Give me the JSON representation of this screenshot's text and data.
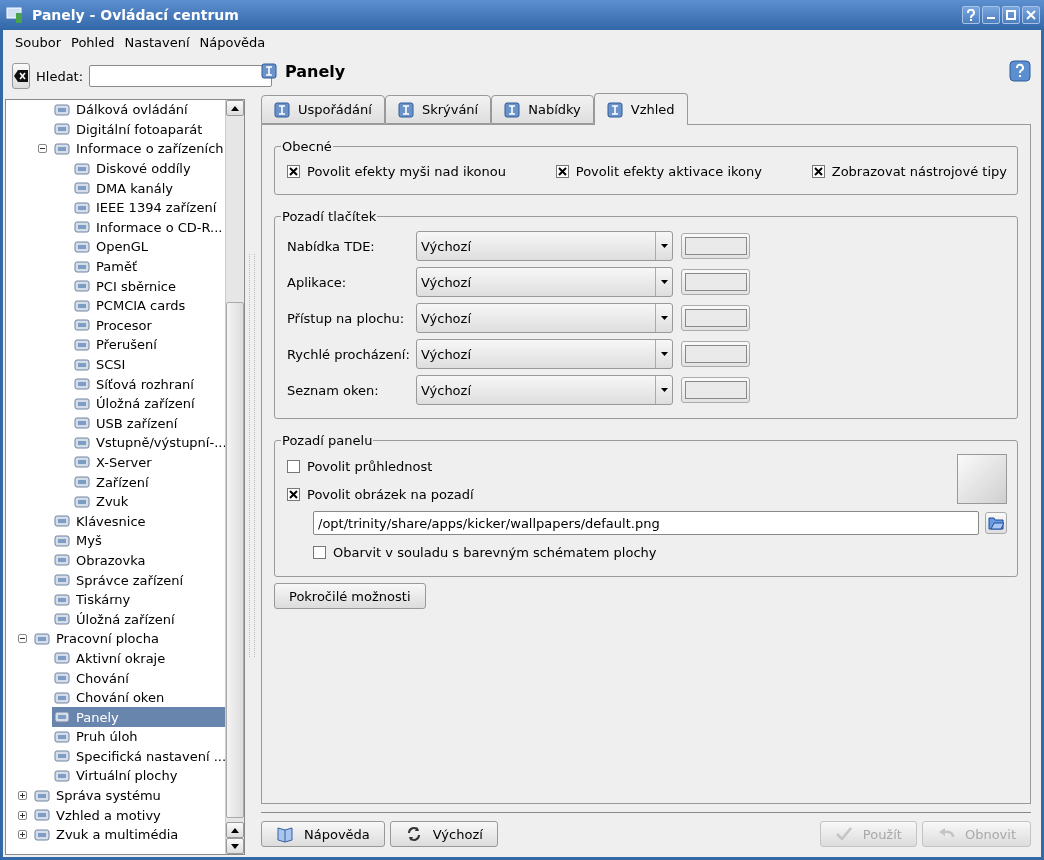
{
  "window": {
    "title": "Panely - Ovládací centrum"
  },
  "menu": [
    {
      "label": "Soubor"
    },
    {
      "label": "Pohled"
    },
    {
      "label": "Nastavení"
    },
    {
      "label": "Nápověda"
    }
  ],
  "search": {
    "label": "Hledat:"
  },
  "tree": {
    "partial_group": {
      "children": [
        {
          "label": "Dálková ovládání"
        },
        {
          "label": "Digitální fotoaparát"
        },
        {
          "label": "Informace o zařízeních",
          "expanded": true,
          "children": [
            {
              "label": "Diskové oddíly"
            },
            {
              "label": "DMA kanály"
            },
            {
              "label": "IEEE 1394 zařízení"
            },
            {
              "label": "Informace o CD-R..."
            },
            {
              "label": "OpenGL"
            },
            {
              "label": "Paměť"
            },
            {
              "label": "PCI sběrnice"
            },
            {
              "label": "PCMCIA cards"
            },
            {
              "label": "Procesor"
            },
            {
              "label": "Přerušení"
            },
            {
              "label": "SCSI"
            },
            {
              "label": "Síťová rozhraní"
            },
            {
              "label": "Úložná zařízení"
            },
            {
              "label": "USB zařízení"
            },
            {
              "label": "Vstupně/výstupní-..."
            },
            {
              "label": "X-Server"
            },
            {
              "label": "Zařízení"
            },
            {
              "label": "Zvuk"
            }
          ]
        },
        {
          "label": "Klávesnice"
        },
        {
          "label": "Myš"
        },
        {
          "label": "Obrazovka"
        },
        {
          "label": "Správce zařízení"
        },
        {
          "label": "Tiskárny"
        },
        {
          "label": "Úložná zařízení"
        }
      ]
    },
    "items": [
      {
        "label": "Pracovní plocha",
        "expanded": true,
        "children": [
          {
            "label": "Aktivní okraje",
            "selected": false
          },
          {
            "label": "Chování",
            "selected": false
          },
          {
            "label": "Chování oken",
            "selected": false
          },
          {
            "label": "Panely",
            "selected": true
          },
          {
            "label": "Pruh úloh",
            "selected": false
          },
          {
            "label": "Specifická nastavení ...",
            "selected": false
          },
          {
            "label": "Virtuální plochy",
            "selected": false
          }
        ]
      },
      {
        "label": "Správa systému",
        "expanded": false
      },
      {
        "label": "Vzhled a motivy",
        "expanded": false
      },
      {
        "label": "Zvuk a multimédia",
        "expanded": false
      }
    ]
  },
  "page": {
    "title": "Panely",
    "tabs": [
      {
        "label": "Uspořádání",
        "selected": false
      },
      {
        "label": "Skrývání",
        "selected": false
      },
      {
        "label": "Nabídky",
        "selected": false
      },
      {
        "label": "Vzhled",
        "selected": true
      }
    ],
    "general": {
      "title": "Obecné",
      "checkboxes": [
        {
          "label": "Povolit efekty myši nad ikonou",
          "checked": true
        },
        {
          "label": "Povolit efekty aktivace ikony",
          "checked": true
        },
        {
          "label": "Zobrazovat nástrojové tipy",
          "checked": true
        }
      ]
    },
    "button_backgrounds": {
      "title": "Pozadí tlačítek",
      "rows": [
        {
          "label": "Nabídka TDE:",
          "value": "Výchozí"
        },
        {
          "label": "Aplikace:",
          "value": "Výchozí"
        },
        {
          "label": "Přístup na plochu:",
          "value": "Výchozí"
        },
        {
          "label": "Rychlé procházení:",
          "value": "Výchozí"
        },
        {
          "label": "Seznam oken:",
          "value": "Výchozí"
        }
      ]
    },
    "panel_background": {
      "title": "Pozadí panelu",
      "transparency": {
        "label": "Povolit průhlednost",
        "checked": false
      },
      "image": {
        "label": "Povolit obrázek na pozadí",
        "checked": true
      },
      "path": "/opt/trinity/share/apps/kicker/wallpapers/default.png",
      "colorize": {
        "label": "Obarvit v souladu s barevným schématem plochy",
        "checked": false
      }
    },
    "advanced_button": "Pokročilé možnosti"
  },
  "footer": {
    "left": [
      {
        "label": "Nápověda",
        "kind": "help",
        "disabled": false
      },
      {
        "label": "Výchozí",
        "kind": "defaults",
        "disabled": false
      }
    ],
    "right": [
      {
        "label": "Použít",
        "kind": "apply",
        "disabled": true
      },
      {
        "label": "Obnovit",
        "kind": "reset",
        "disabled": true
      }
    ]
  }
}
